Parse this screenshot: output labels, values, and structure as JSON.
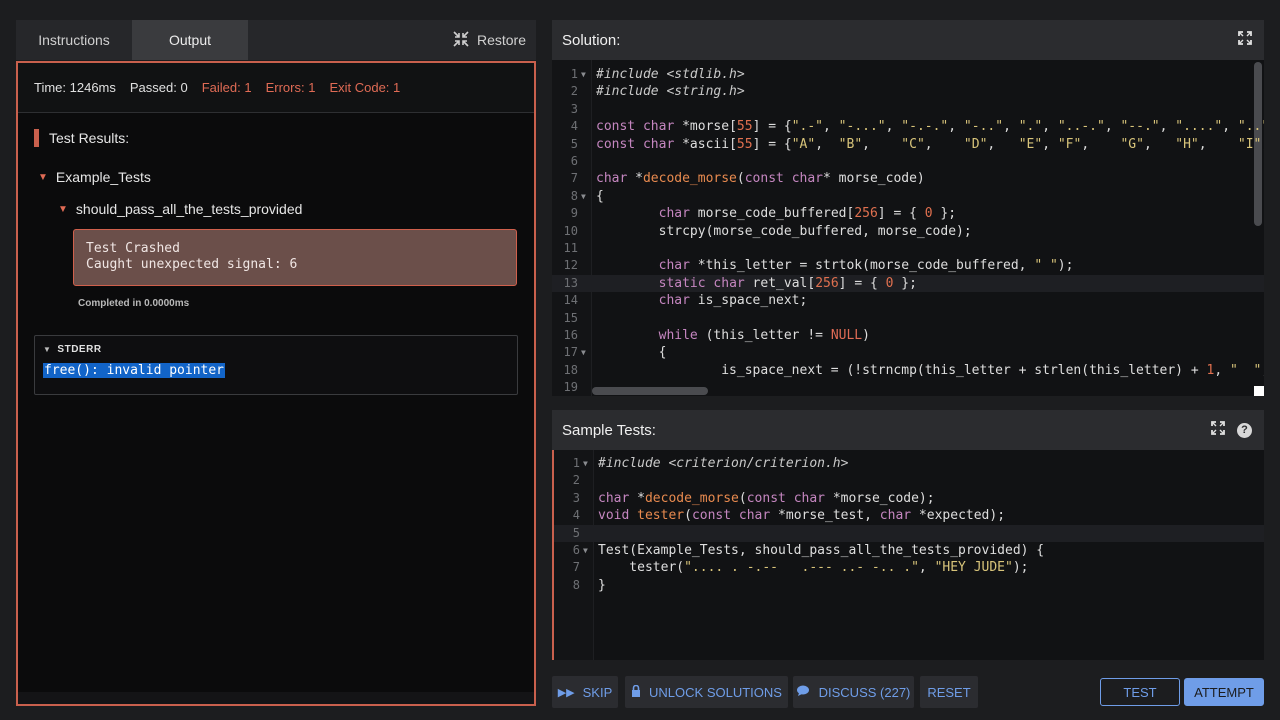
{
  "left_tabs": {
    "instructions": "Instructions",
    "output": "Output",
    "restore": "Restore"
  },
  "status": {
    "time": "Time: 1246ms",
    "passed": "Passed: 0",
    "failed": "Failed: 1",
    "errors": "Errors: 1",
    "exit_code": "Exit Code: 1"
  },
  "results": {
    "title": "Test Results:",
    "group": "Example_Tests",
    "test": "should_pass_all_the_tests_provided",
    "crash_line1": "Test Crashed",
    "crash_line2": "Caught unexpected signal: 6",
    "completed": "Completed in 0.0000ms",
    "stderr_title": "STDERR",
    "stderr_text": "free(): invalid pointer"
  },
  "solution": {
    "title": "Solution:",
    "lines": [
      {
        "n": "1",
        "fold": true,
        "html": "<span class='c'>#include &lt;stdlib.h&gt;</span>"
      },
      {
        "n": "2",
        "fold": false,
        "html": "<span class='c'>#include &lt;string.h&gt;</span>"
      },
      {
        "n": "3",
        "fold": false,
        "html": ""
      },
      {
        "n": "4",
        "fold": false,
        "html": "<span class='k'>const</span> <span class='k'>char</span> *morse[<span class='n'>55</span>] = {<span class='s'>\".-\"</span>, <span class='s'>\"-...\"</span>, <span class='s'>\"-.-.\"</span>, <span class='s'>\"-..\"</span>, <span class='s'>\".\"</span>, <span class='s'>\"..-.\"</span>, <span class='s'>\"--.\"</span>, <span class='s'>\"....\"</span>, <span class='s'>\"..\"</span>"
      },
      {
        "n": "5",
        "fold": false,
        "html": "<span class='k'>const</span> <span class='k'>char</span> *ascii[<span class='n'>55</span>] = {<span class='s'>\"A\"</span>,  <span class='s'>\"B\"</span>,    <span class='s'>\"C\"</span>,    <span class='s'>\"D\"</span>,   <span class='s'>\"E\"</span>, <span class='s'>\"F\"</span>,    <span class='s'>\"G\"</span>,   <span class='s'>\"H\"</span>,    <span class='s'>\"I\"</span>,"
      },
      {
        "n": "6",
        "fold": false,
        "html": ""
      },
      {
        "n": "7",
        "fold": false,
        "html": "<span class='k'>char</span> *<span class='f'>decode_morse</span>(<span class='k'>const</span> <span class='k'>char</span>* morse_code)"
      },
      {
        "n": "8",
        "fold": true,
        "html": "{"
      },
      {
        "n": "9",
        "fold": false,
        "html": "        <span class='k'>char</span> morse_code_buffered[<span class='n'>256</span>] = { <span class='n'>0</span> };"
      },
      {
        "n": "10",
        "fold": false,
        "html": "        strcpy(morse_code_buffered, morse_code);"
      },
      {
        "n": "11",
        "fold": false,
        "html": ""
      },
      {
        "n": "12",
        "fold": false,
        "html": "        <span class='k'>char</span> *this_letter = strtok(morse_code_buffered, <span class='s'>\" \"</span>);"
      },
      {
        "n": "13",
        "fold": false,
        "hl": true,
        "html": "        <span class='k'>static</span> <span class='k'>char</span> ret_val[<span class='n'>256</span>] = { <span class='n'>0</span> };"
      },
      {
        "n": "14",
        "fold": false,
        "html": "        <span class='k'>char</span> is_space_next;"
      },
      {
        "n": "15",
        "fold": false,
        "html": ""
      },
      {
        "n": "16",
        "fold": false,
        "html": "        <span class='k'>while</span> (this_letter != <span class='nl'>NULL</span>)"
      },
      {
        "n": "17",
        "fold": true,
        "html": "        {"
      },
      {
        "n": "18",
        "fold": false,
        "html": "                is_space_next = (!strncmp(this_letter + strlen(this_letter) + <span class='n'>1</span>, <span class='s'>\"  \"</span>,"
      },
      {
        "n": "19",
        "fold": false,
        "html": ""
      }
    ]
  },
  "sample_tests": {
    "title": "Sample Tests:",
    "help": "?",
    "lines": [
      {
        "n": "1",
        "fold": true,
        "html": "<span class='c'>#include &lt;criterion/criterion.h&gt;</span>"
      },
      {
        "n": "2",
        "fold": false,
        "html": ""
      },
      {
        "n": "3",
        "fold": false,
        "html": "<span class='k'>char</span> *<span class='f'>decode_morse</span>(<span class='k'>const</span> <span class='k'>char</span> *morse_code);"
      },
      {
        "n": "4",
        "fold": false,
        "html": "<span class='k'>void</span> <span class='f'>tester</span>(<span class='k'>const</span> <span class='k'>char</span> *morse_test, <span class='k'>char</span> *expected);"
      },
      {
        "n": "5",
        "fold": false,
        "hl": true,
        "html": ""
      },
      {
        "n": "6",
        "fold": true,
        "html": "Test(Example_Tests, should_pass_all_the_tests_provided) {"
      },
      {
        "n": "7",
        "fold": false,
        "html": "    tester(<span class='s'>\".... . -.--   .--- ..- -.. .\"</span>, <span class='s'>\"HEY JUDE\"</span>);"
      },
      {
        "n": "8",
        "fold": false,
        "html": "}"
      }
    ]
  },
  "actions": {
    "skip": "SKIP",
    "unlock": "UNLOCK SOLUTIONS",
    "discuss": "DISCUSS (227)",
    "reset": "RESET",
    "test": "TEST",
    "attempt": "ATTEMPT"
  },
  "colors": {
    "accent_red": "#c9604d",
    "accent_blue": "#6f9de8",
    "attempt_bg": "#6f9de8"
  }
}
